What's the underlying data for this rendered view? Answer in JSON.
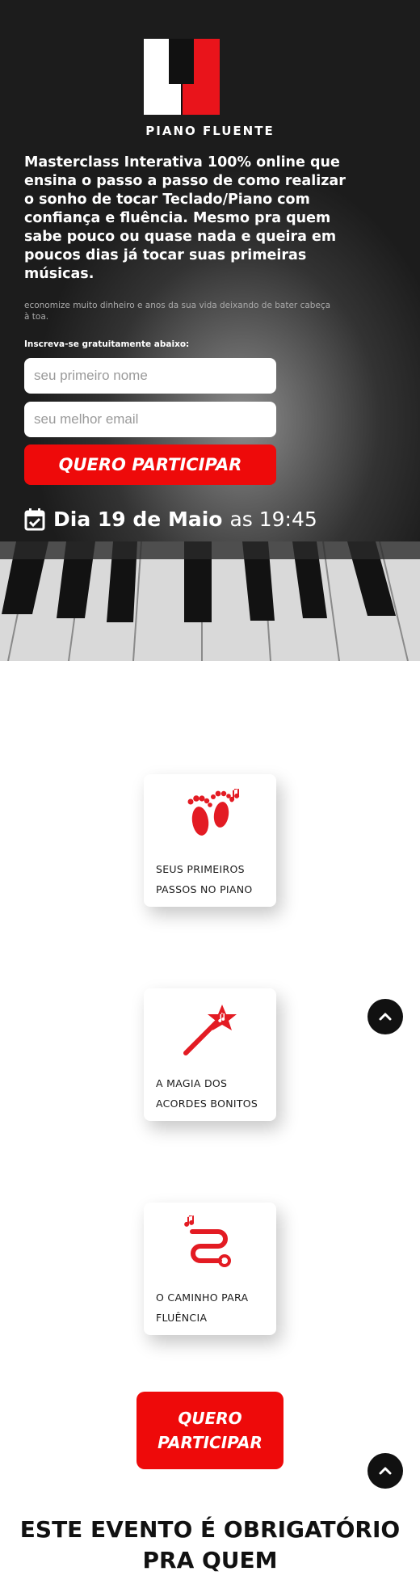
{
  "brand": {
    "name": "PIANO FLUENTE",
    "logo_icon": "piano-keys-logo"
  },
  "hero": {
    "headline": "Masterclass Interativa 100% online que ensina o passo a passo de como realizar o sonho de tocar Teclado/Piano com confiança e fluência. Mesmo pra quem sabe pouco ou quase nada e queira em poucos dias já tocar suas primeiras músicas.",
    "subnote": "economize muito dinheiro e anos da sua vida deixando de bater cabeça à toa.",
    "form_label": "Inscreva-se gratuitamente abaixo:",
    "name_placeholder": "seu primeiro nome",
    "email_placeholder": "seu melhor email",
    "cta_label": "QUERO PARTICIPAR",
    "date": {
      "icon": "calendar-check-icon",
      "day": "Dia 19 de Maio",
      "time": "as 19:45"
    }
  },
  "features": [
    {
      "icon": "footprints-icon",
      "caption": "SEUS PRIMEIROS PASSOS NO PIANO"
    },
    {
      "icon": "magic-wand-icon",
      "caption": "A MAGIA DOS ACORDES BONITOS"
    },
    {
      "icon": "path-icon",
      "caption": "O CAMINHO PARA FLUÊNCIA"
    }
  ],
  "bottom_cta": {
    "label": "QUERO PARTICIPAR"
  },
  "section_heading": "ESTE EVENTO É OBRIGATÓRIO PRA QUEM",
  "colors": {
    "accent": "#ee0a0a",
    "hero_bg": "#1c1c1c",
    "text_dark": "#111111"
  }
}
